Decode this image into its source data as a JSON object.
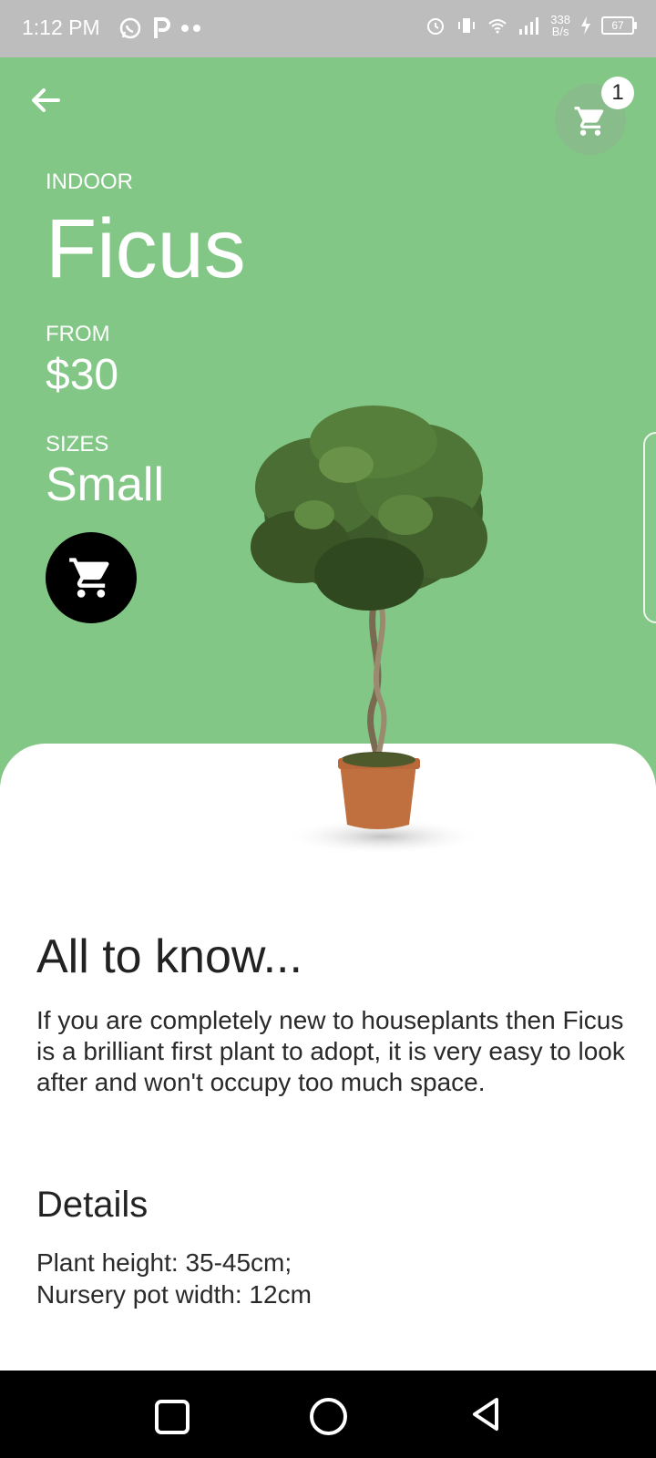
{
  "status_bar": {
    "time": "1:12 PM",
    "net_speed_value": "338",
    "net_speed_unit": "B/s",
    "battery": "67"
  },
  "header": {
    "cart_count": "1"
  },
  "plant": {
    "category": "INDOOR",
    "name": "Ficus",
    "from_label": "FROM",
    "price": "$30",
    "sizes_label": "SIZES",
    "size": "Small"
  },
  "info": {
    "title": "All to know...",
    "body": "If you are completely new to houseplants then Ficus is a brilliant first plant to adopt, it is very easy to look after and won't occupy too much space."
  },
  "details": {
    "title": "Details",
    "lines": [
      "Plant height: 35-45cm;",
      "Nursery pot width: 12cm"
    ]
  },
  "colors": {
    "hero_green": "#82c785",
    "button_black": "#000000"
  }
}
